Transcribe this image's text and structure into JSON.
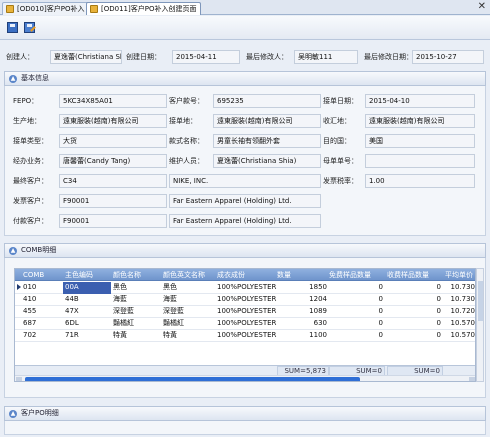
{
  "tabs": [
    {
      "label": "[OD010]客户PO补入"
    },
    {
      "label": "[OD011]客户PO补入创建页面"
    }
  ],
  "header": {
    "creator_label": "创建人：",
    "creator": "夏逸蕾(Christiana Shia)",
    "created_date_label": "创建日期：",
    "created_date": "2015-04-11",
    "modifier_label": "最后修改人：",
    "modifier": "吴明敏111",
    "modified_date_label": "最后修改日期：",
    "modified_date": "2015-10-27"
  },
  "basic": {
    "title": "基本信息",
    "fepo_label": "FEPO：",
    "fepo": "5KC34X85A01",
    "custno_label": "客户款号：",
    "custno": "695235",
    "orderdate_label": "接单日期：",
    "orderdate": "2015-04-10",
    "prodplace_label": "生产地：",
    "prodplace": "遠東服裝(越南)有限公司",
    "orderplace_label": "接单地：",
    "orderplace": "遠東服裝(越南)有限公司",
    "receiveplace_label": "收汇地：",
    "receiveplace": "遠東服裝(越南)有限公司",
    "ordertype_label": "接单类型：",
    "ordertype": "大货",
    "stylename_label": "款式名称：",
    "stylename": "男童长袖有领翻外套",
    "destination_label": "目的国：",
    "destination": "美国",
    "sales_label": "经办业务：",
    "sales": "唐馨蕾(Candy Tang)",
    "maintainer_label": "维护人员：",
    "maintainer": "夏逸蕾(Christiana Shia)",
    "parentorder_label": "母单单号：",
    "parentorder": "",
    "finalcust_label": "最终客户：",
    "finalcust_code": "C34",
    "finalcust_name": "NIKE, INC.",
    "taxrate_label": "发票税率：",
    "taxrate": "1.00",
    "invoicecust_label": "发票客户：",
    "invoicecust_code": "F90001",
    "invoicecust_name": "Far Eastern Apparel (Holding) Ltd.",
    "paycust_label": "付款客户：",
    "paycust_code": "F90001",
    "paycust_name": "Far Eastern Apparel (Holding) Ltd."
  },
  "comb": {
    "title": "COMB明细",
    "columns": [
      "COMB",
      "主色编码",
      "颜色名称",
      "颜色英文名称",
      "成衣成份",
      "数量",
      "免费样品数量",
      "收费样品数量",
      "平均单价"
    ],
    "rows": [
      [
        "010",
        "00A",
        "黑色",
        "黑色",
        "100%POLYESTER",
        "1850",
        "0",
        "0",
        "10.730"
      ],
      [
        "410",
        "44B",
        "海藍",
        "海藍",
        "100%POLYESTER",
        "1204",
        "0",
        "0",
        "10.730"
      ],
      [
        "455",
        "47X",
        "深登藍",
        "深登藍",
        "100%POLYESTER",
        "1089",
        "0",
        "0",
        "10.720"
      ],
      [
        "687",
        "6DL",
        "豔橘紅",
        "豔橘紅",
        "100%POLYESTER",
        "630",
        "0",
        "0",
        "10.570"
      ],
      [
        "702",
        "71R",
        "特黃",
        "特黃",
        "100%POLYESTER",
        "1100",
        "0",
        "0",
        "10.570"
      ]
    ],
    "sums": [
      "SUM=5,873",
      "SUM=0",
      "SUM=0"
    ]
  },
  "po": {
    "title": "客户PO明细"
  },
  "icons": {
    "save": "save-icon",
    "saveas": "save-edit-icon",
    "collapse": "collapse-icon"
  }
}
